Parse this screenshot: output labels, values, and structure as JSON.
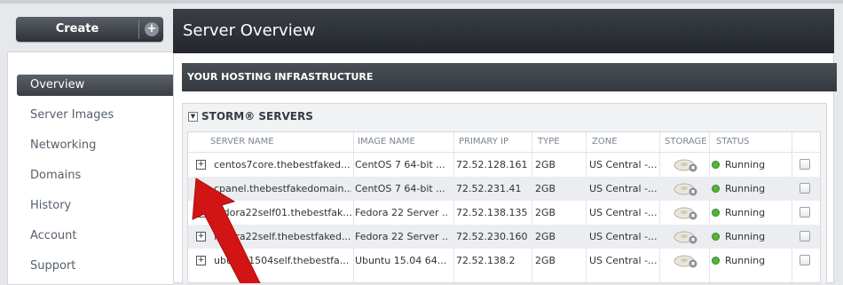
{
  "sidebar": {
    "create_label": "Create",
    "create_plus": "+",
    "nav": [
      {
        "label": "Overview",
        "active": true
      },
      {
        "label": "Server Images"
      },
      {
        "label": "Networking"
      },
      {
        "label": "Domains"
      },
      {
        "label": "History"
      },
      {
        "label": "Account"
      },
      {
        "label": "Support"
      }
    ]
  },
  "main": {
    "title": "Server Overview",
    "infra_label": "YOUR HOSTING INFRASTRUCTURE",
    "section_title": "STORM® SERVERS",
    "columns": [
      "SERVER NAME",
      "IMAGE NAME",
      "PRIMARY IP",
      "TYPE",
      "ZONE",
      "STORAGE",
      "STATUS"
    ],
    "rows": [
      {
        "name": "centos7core.thebestfaked...",
        "image": "CentOS 7 64-bit ...",
        "ip": "72.52.128.161",
        "type": "2GB",
        "zone": "US Central -...",
        "status": "Running"
      },
      {
        "name": "cpanel.thebestfakedomain...",
        "image": "CentOS 7 64-bit ...",
        "ip": "72.52.231.41",
        "type": "2GB",
        "zone": "US Central -...",
        "status": "Running"
      },
      {
        "name": "fedora22self01.thebestfak...",
        "image": "Fedora 22 Server ...",
        "ip": "72.52.138.135",
        "type": "2GB",
        "zone": "US Central -...",
        "status": "Running"
      },
      {
        "name": "fedora22self.thebestfaked...",
        "image": "Fedora 22 Server ...",
        "ip": "72.52.230.160",
        "type": "2GB",
        "zone": "US Central -...",
        "status": "Running"
      },
      {
        "name": "ubuntu1504self.thebestfa...",
        "image": "Ubuntu 15.04 64...",
        "ip": "72.52.138.2",
        "type": "2GB",
        "zone": "US Central -...",
        "status": "Running"
      }
    ]
  },
  "colors": {
    "status_running": "#56b23a",
    "arrow": "#d21414",
    "header_dark": "#2b2f35"
  }
}
